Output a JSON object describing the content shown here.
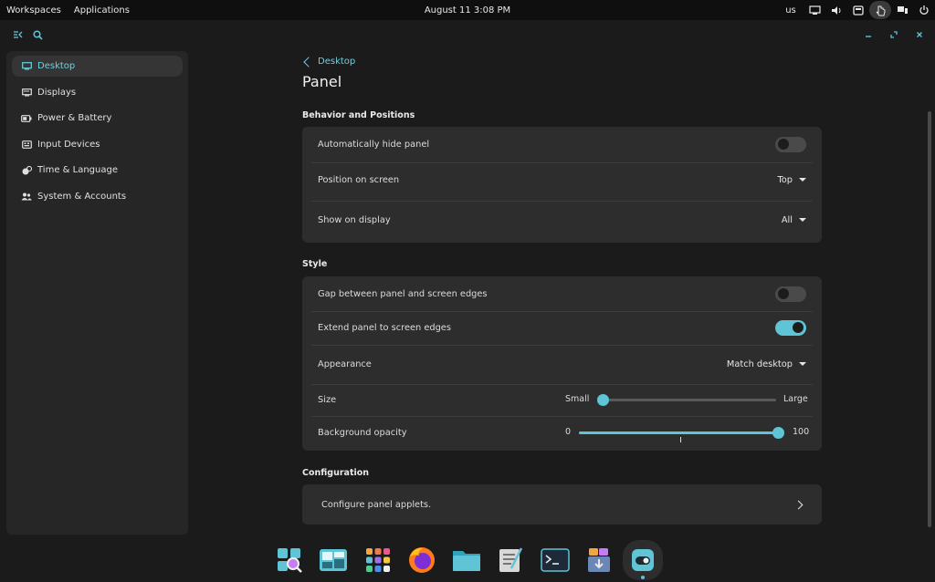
{
  "topbar": {
    "workspaces": "Workspaces",
    "applications": "Applications",
    "clock": "August 11 3:08 PM",
    "keyboard": "us",
    "tray_icons": [
      "network-icon",
      "volume-icon",
      "notifications-icon",
      "pointer-icon",
      "display-icon",
      "power-icon"
    ]
  },
  "header": {
    "left_icons": [
      "sidebar-toggle-icon",
      "search-icon"
    ],
    "window_buttons": [
      "minimize-icon",
      "maximize-icon",
      "close-icon"
    ]
  },
  "sidebar": {
    "items": [
      {
        "label": "Desktop",
        "icon": "desktop-icon",
        "active": true
      },
      {
        "label": "Displays",
        "icon": "displays-icon",
        "active": false
      },
      {
        "label": "Power & Battery",
        "icon": "battery-icon",
        "active": false
      },
      {
        "label": "Input Devices",
        "icon": "keyboard-icon",
        "active": false
      },
      {
        "label": "Time & Language",
        "icon": "time-language-icon",
        "active": false
      },
      {
        "label": "System & Accounts",
        "icon": "accounts-icon",
        "active": false
      }
    ]
  },
  "page": {
    "back_label": "Desktop",
    "title": "Panel"
  },
  "behavior": {
    "heading": "Behavior and Positions",
    "auto_hide": {
      "label": "Automatically hide panel",
      "on": false
    },
    "position": {
      "label": "Position on screen",
      "value": "Top"
    },
    "show_on": {
      "label": "Show on display",
      "value": "All"
    }
  },
  "style": {
    "heading": "Style",
    "gap": {
      "label": "Gap between panel and screen edges",
      "on": false
    },
    "extend": {
      "label": "Extend panel to screen edges",
      "on": true
    },
    "appearance": {
      "label": "Appearance",
      "value": "Match desktop"
    },
    "size": {
      "label": "Size",
      "min_label": "Small",
      "max_label": "Large",
      "value_fraction": 0.0
    },
    "opacity": {
      "label": "Background opacity",
      "min_label": "0",
      "max_label": "100",
      "value": 100
    }
  },
  "configuration": {
    "heading": "Configuration",
    "applets": {
      "label": "Configure panel applets."
    }
  },
  "dock": {
    "apps": [
      "app-library-icon",
      "workspaces-icon",
      "launcher-icon",
      "firefox-icon",
      "files-icon",
      "text-editor-icon",
      "terminal-icon",
      "store-icon",
      "settings-icon"
    ],
    "colors": {
      "accent": "#5ec4d6"
    }
  }
}
